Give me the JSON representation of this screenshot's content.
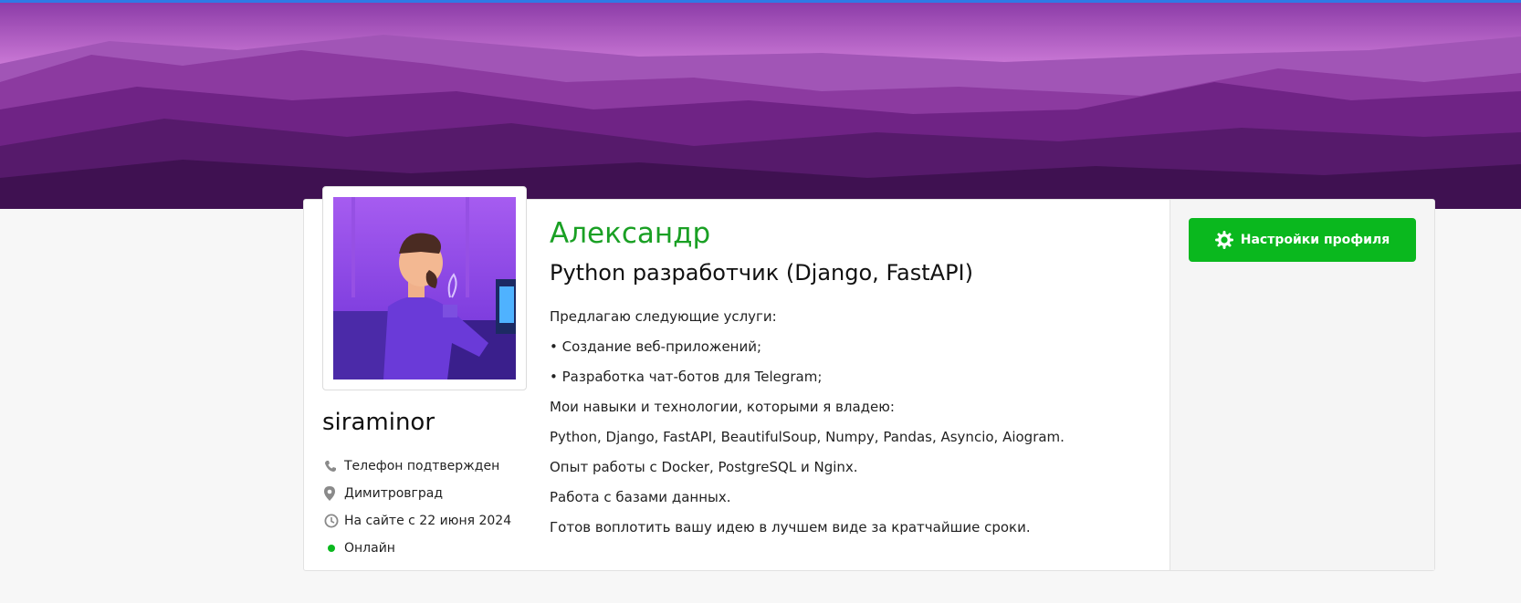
{
  "profile": {
    "first_name": "Александр",
    "title": "Python разработчик (Django, FastAPI)",
    "username": "siraminor",
    "phone_status": "Телефон подтвержден",
    "city": "Димитровград",
    "member_since": "На сайте с 22 июня 2024",
    "status": "Онлайн",
    "description": [
      "Предлагаю следующие услуги:",
      "• Создание веб-приложений;",
      "• Разработка чат-ботов для Telegram;",
      "Мои навыки и технологии, которыми я владею:",
      "Python, Django, FastAPI, BeautifulSoup, Numpy, Pandas, Asyncio, Aiogram.",
      "Опыт работы с Docker, PostgreSQL и Nginx.",
      "Работа с базами данных.",
      "Готов воплотить вашу идею в лучшем виде за кратчайшие сроки."
    ]
  },
  "actions": {
    "settings_label": "Настройки профиля"
  },
  "icons": {
    "phone": "phone-icon",
    "location": "location-pin-icon",
    "clock": "clock-icon",
    "online": "online-dot-icon",
    "settings": "gear-icon"
  },
  "colors": {
    "accent_green": "#0ab81e",
    "name_green": "#1aa024",
    "cover_purple": "#7a1d8f"
  }
}
